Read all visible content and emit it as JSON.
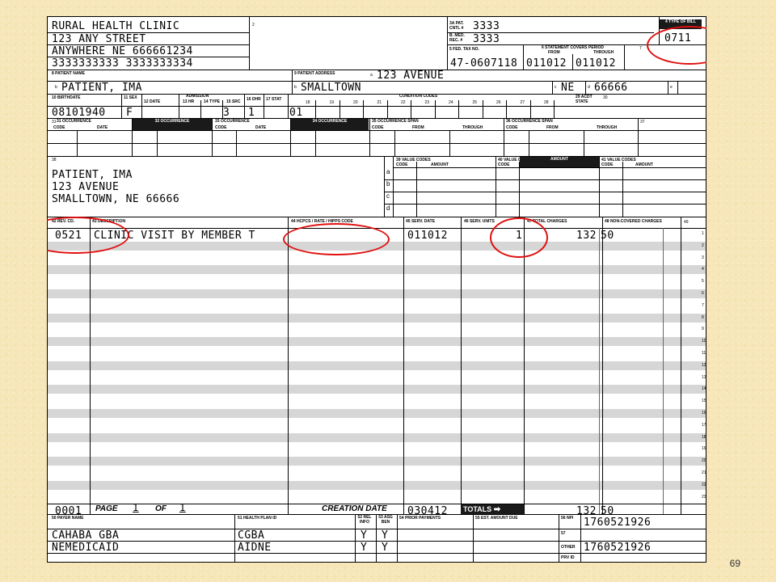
{
  "provider": {
    "name": "RURAL HEALTH CLINIC",
    "street": "123 ANY STREET",
    "city_line": "ANYWHERE         NE 666661234",
    "phones": "3333333333  3333333334"
  },
  "header_labels": {
    "field2": "2",
    "pat_cntl": "3a PAT. CNTL #",
    "med_rec": "b. MED. REC. #",
    "type_of_bill": "4 TYPE OF BILL",
    "fed_tax": "5 FED. TAX NO.",
    "stmt_period": "6 STATEMENT COVERS PERIOD",
    "from": "FROM",
    "through": "THROUGH",
    "field7": "7"
  },
  "header_values": {
    "pat_cntl": "3333",
    "med_rec": "3333",
    "type_of_bill": "0711",
    "fed_tax": "47-0607118",
    "from_date": "011012",
    "through_date": "011012"
  },
  "patient_row": {
    "name_label": "8 PATIENT NAME",
    "name_prefix": "a",
    "name_b": "b",
    "name": "PATIENT, IMA",
    "address_label": "9 PATIENT ADDRESS",
    "address_a": "a",
    "address": "123 AVENUE",
    "city_b": "b",
    "city": "SMALLTOWN",
    "state_c": "c",
    "state": "NE",
    "zip_d": "d",
    "zip": "66666",
    "e": "e"
  },
  "admission_labels": {
    "birthdate": "10 BIRTHDATE",
    "sex": "11 SEX",
    "admission": "ADMISSION",
    "date": "12 DATE",
    "hr": "13 HR",
    "type": "14 TYPE",
    "src": "15 SRC",
    "dhr": "16 DHR",
    "stat": "17 STAT",
    "condition_codes": "CONDITION CODES",
    "acdt_state": "29 ACDT STATE",
    "f30": "30",
    "cc_nums": [
      "18",
      "19",
      "20",
      "21",
      "22",
      "23",
      "24",
      "25",
      "26",
      "27",
      "28"
    ]
  },
  "admission_values": {
    "birthdate": "08101940",
    "sex": "F",
    "type": "3",
    "src": "1",
    "stat": "01"
  },
  "occurrence_labels": {
    "o31": "31 OCCURRENCE",
    "o32": "32 OCCURRENCE",
    "o33": "33 OCCURRENCE",
    "o34": "34 OCCURRENCE",
    "o35": "35 OCCURRENCE SPAN",
    "o36": "36 OCCURRENCE SPAN",
    "f37": "37",
    "code": "CODE",
    "date": "DATE",
    "from": "FROM",
    "through": "THROUGH"
  },
  "responsible_party": {
    "label": "38",
    "line1": "PATIENT, IMA",
    "line2": "123 AVENUE",
    "line3": "SMALLTOWN, NE 66666",
    "letters": [
      "a",
      "b",
      "c",
      "d"
    ]
  },
  "value_codes": {
    "v39": "39 VALUE CODES",
    "v40": "40 VALUE CODES",
    "v41": "41 VALUE CODES",
    "code": "CODE",
    "amount": "AMOUNT"
  },
  "line_headers": {
    "rev_cd": "42 REV. CD.",
    "description": "43 DESCRIPTION",
    "hcpcs": "44 HCPCS / RATE / HIPPS CODE",
    "serv_date": "45 SERV. DATE",
    "serv_units": "46 SERV. UNITS",
    "total_charges": "47 TOTAL CHARGES",
    "non_covered": "48 NON-COVERED CHARGES",
    "f49": "49"
  },
  "line_item": {
    "rev_cd": "0521",
    "description": "CLINIC VISIT BY MEMBER T",
    "serv_date": "011012",
    "serv_units": "1",
    "charge_dollars": "132",
    "charge_cents": "50"
  },
  "totals_row": {
    "rev_cd": "0001",
    "page_label": "PAGE",
    "page_num": "1",
    "of_label": "OF",
    "of_num": "1",
    "creation_label": "CREATION DATE",
    "creation_date": "030412",
    "totals_label": "TOTALS",
    "charge_dollars": "132",
    "charge_cents": "50"
  },
  "payer_labels": {
    "payer_name": "50 PAYER NAME",
    "health_plan_id": "51 HEALTH PLAN ID",
    "rel_info": "52 REL INFO",
    "asg_ben": "53 ASG BEN",
    "prior_payments": "54 PRIOR PAYMENTS",
    "est_amount_due": "55 EST. AMOUNT DUE",
    "npi": "56 NPI",
    "f57": "57",
    "other": "OTHER",
    "prv_id": "PRV ID"
  },
  "payers": [
    {
      "name": "CAHABA GBA",
      "plan": "CGBA",
      "rel": "Y",
      "asg": "Y"
    },
    {
      "name": "NEMEDICAID",
      "plan": "AIDNE",
      "rel": "Y",
      "asg": "Y"
    }
  ],
  "npi": {
    "primary": "1760521926",
    "other": "1760521926"
  },
  "line_numbers": [
    "1",
    "2",
    "3",
    "4",
    "5",
    "6",
    "7",
    "8",
    "9",
    "10",
    "11",
    "12",
    "13",
    "14",
    "15",
    "16",
    "17",
    "18",
    "19",
    "20",
    "21",
    "22",
    "23"
  ],
  "slide_number": "69",
  "colors": {
    "background": "#f6e6b8",
    "highlight_circle": "#e01010",
    "stripe": "#d6d6d6"
  }
}
